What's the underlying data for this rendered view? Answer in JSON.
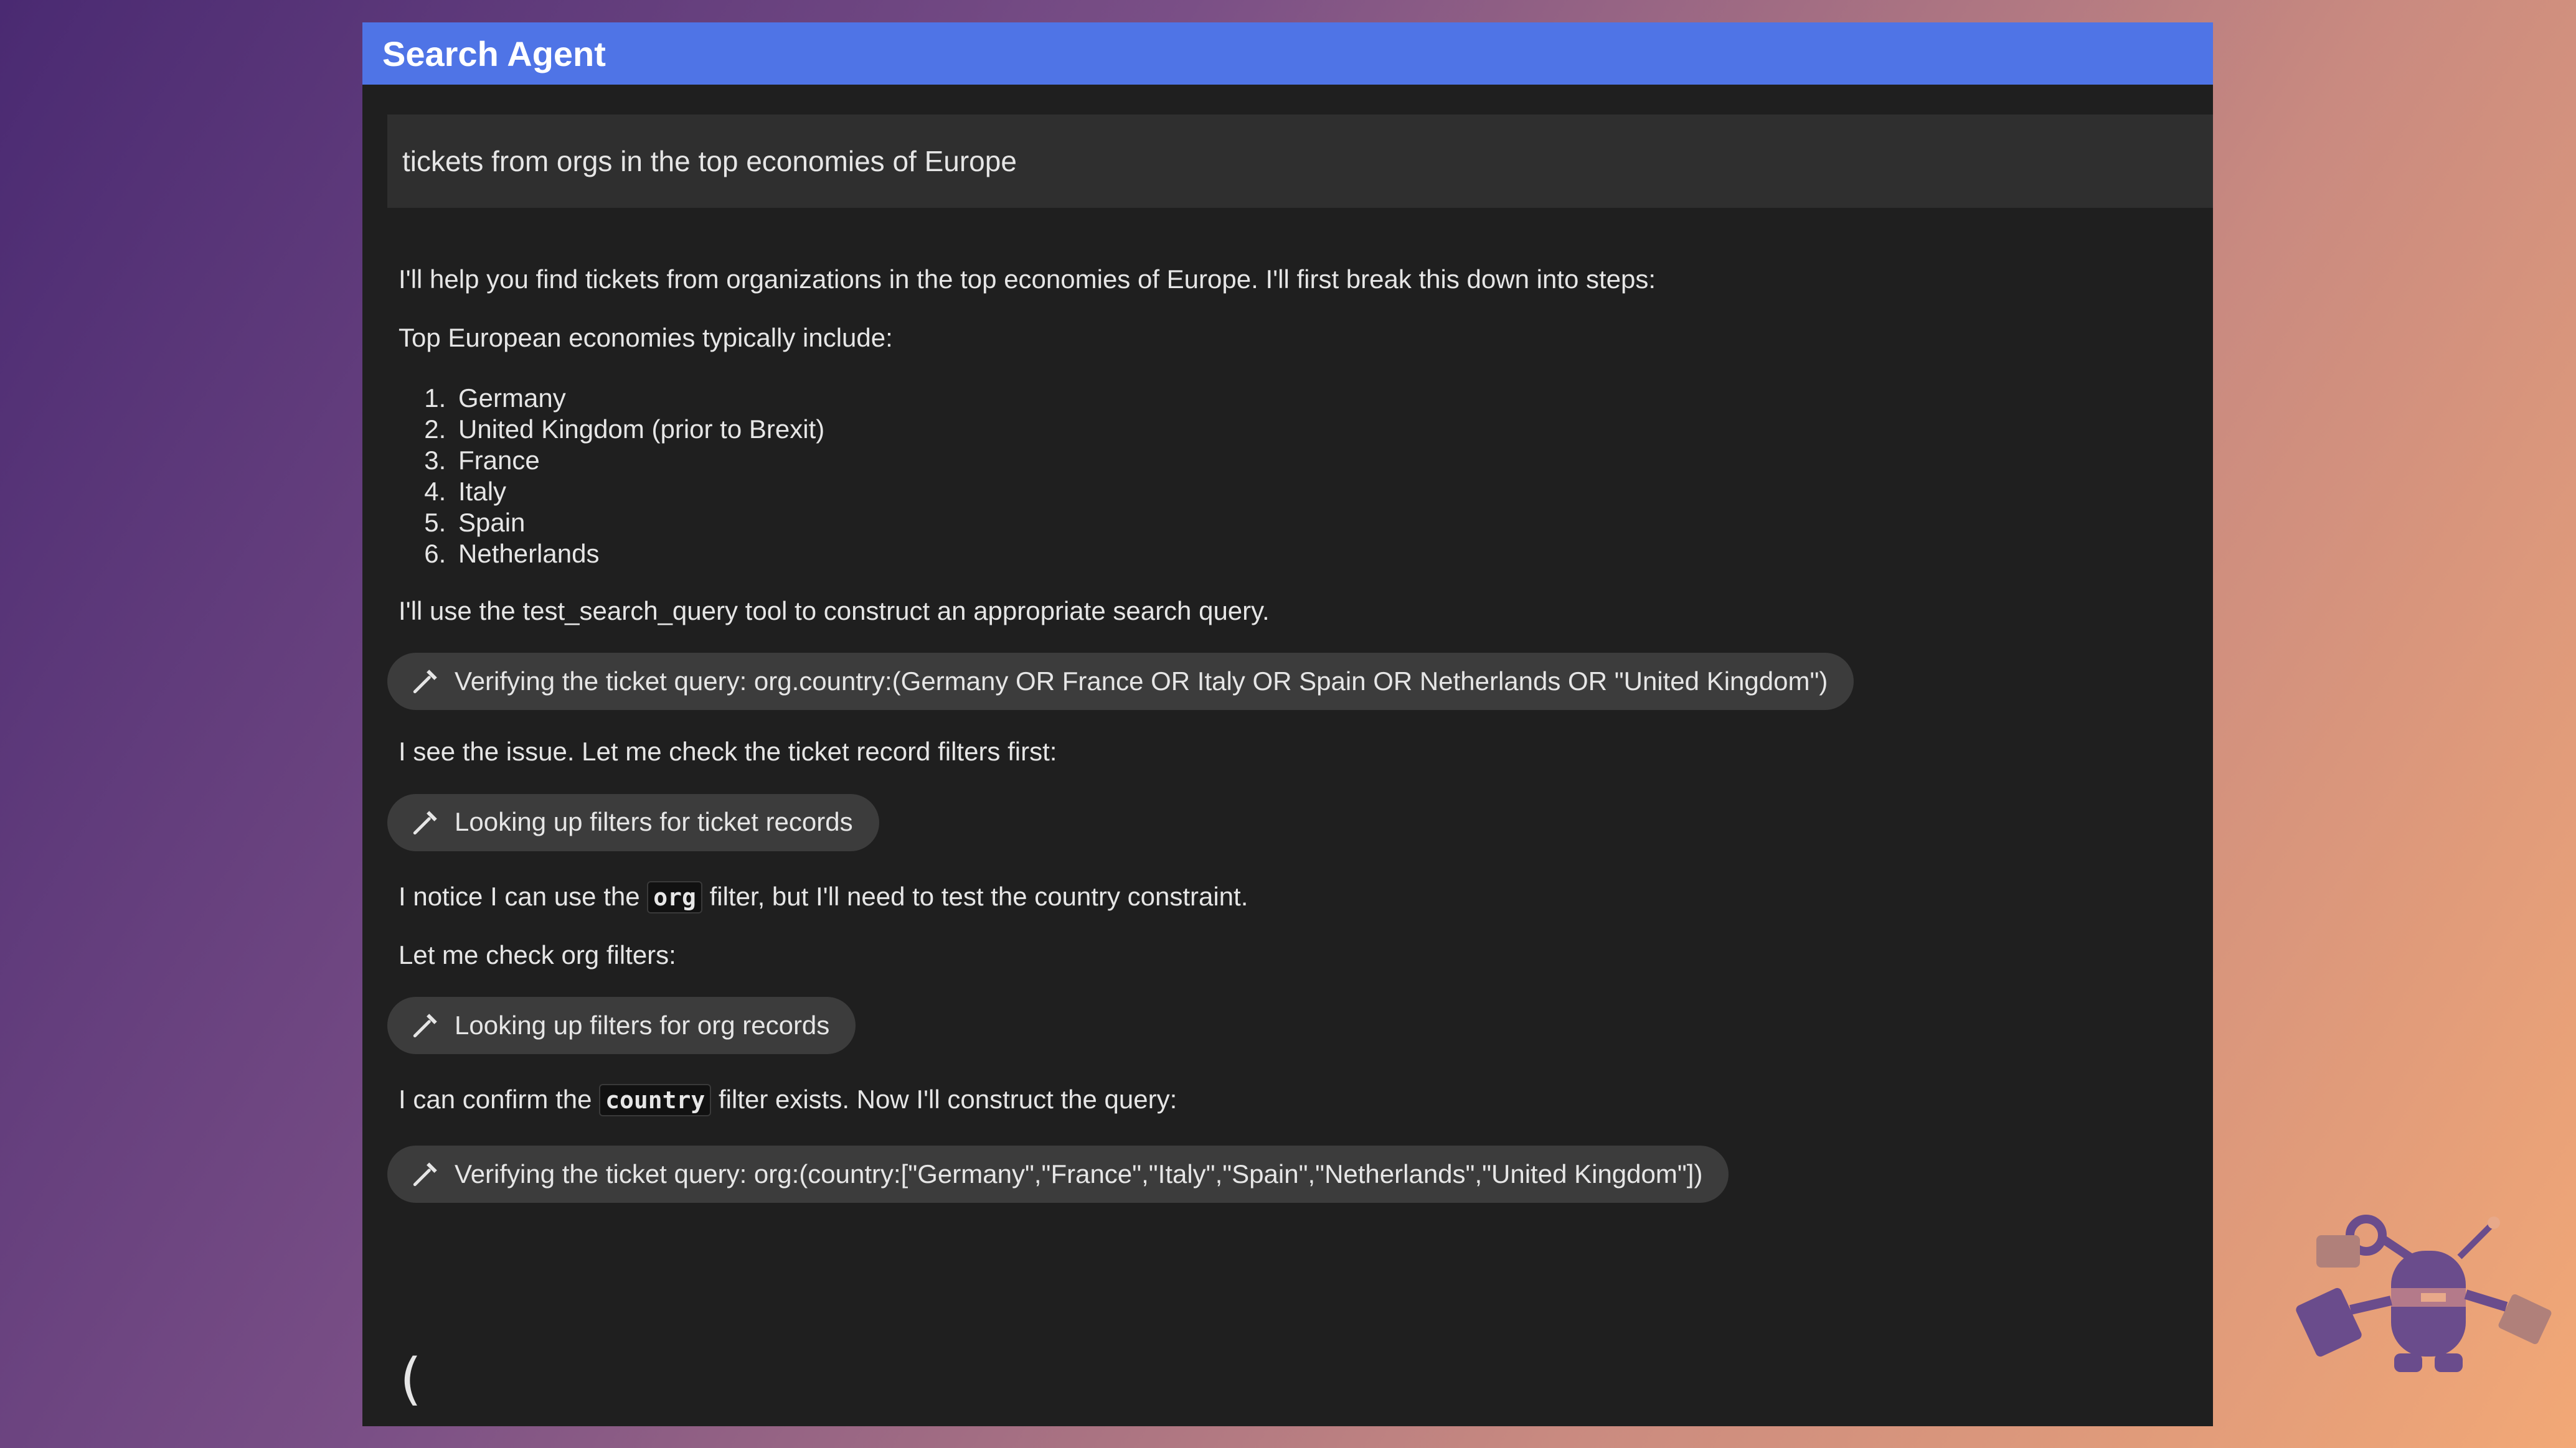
{
  "app": {
    "title": "Search Agent"
  },
  "query": {
    "text": "tickets from orgs in the top economies of Europe"
  },
  "messages": {
    "intro": "I'll help you find tickets from organizations in the top economies of Europe. I'll first break this down into steps:",
    "economies_heading": "Top European economies typically include:",
    "economies": [
      "Germany",
      "United Kingdom (prior to Brexit)",
      "France",
      "Italy",
      "Spain",
      "Netherlands"
    ],
    "use_tool": "I'll use the test_search_query tool to construct an appropriate search query.",
    "tool1": "Verifying the ticket query: org.country:(Germany OR France OR Italy OR Spain OR Netherlands OR \"United Kingdom\")",
    "see_issue": "I see the issue. Let me check the ticket record filters first:",
    "tool2": "Looking up filters for ticket records",
    "notice_pre": "I notice I can use the",
    "notice_code": "org",
    "notice_post": "filter, but I'll need to test the country constraint.",
    "check_org": "Let me check org filters:",
    "tool3": "Looking up filters for org records",
    "confirm_pre": "I can confirm the",
    "confirm_code": "country",
    "confirm_post": "filter exists. Now I'll construct the query:",
    "tool4": "Verifying the ticket query: org:(country:[\"Germany\",\"France\",\"Italy\",\"Spain\",\"Netherlands\",\"United Kingdom\"])",
    "spinner": "("
  },
  "icons": {
    "tool": "hammer-icon",
    "mascot": "robot-mascot-icon"
  },
  "colors": {
    "titlebar": "#4f74e6",
    "panel": "#1f1f1f",
    "chip": "#3c3c3c",
    "mascot": "#6a4c8c"
  }
}
